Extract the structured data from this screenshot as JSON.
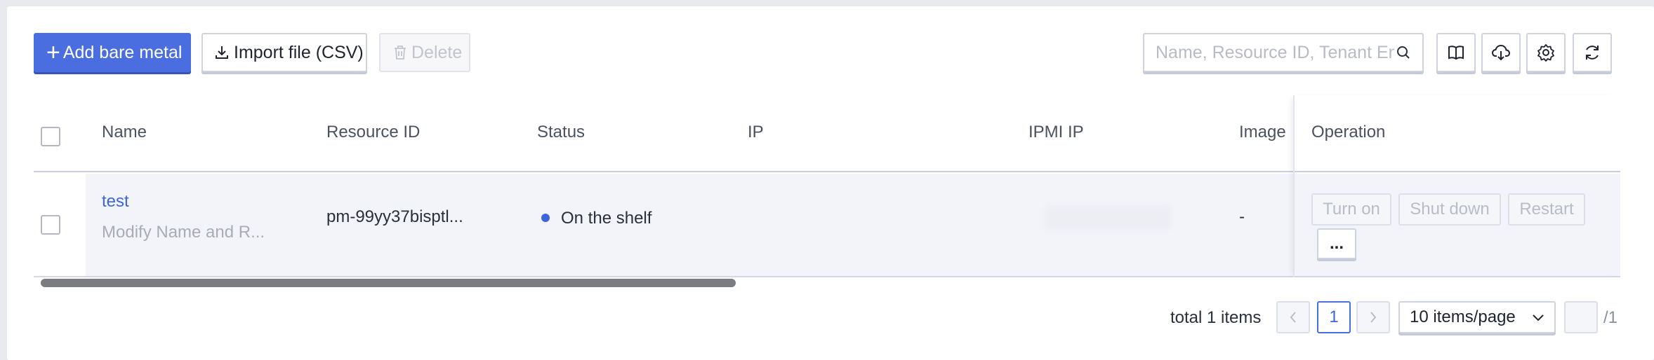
{
  "toolbar": {
    "add_label": "Add bare metal",
    "import_label": "Import file (CSV)",
    "delete_label": "Delete",
    "search_placeholder": "Name, Resource ID, Tenant En",
    "icons": [
      "book-icon",
      "cloud-download-icon",
      "gear-icon",
      "refresh-icon"
    ]
  },
  "table": {
    "columns": [
      "Name",
      "Resource ID",
      "Status",
      "IP",
      "IPMI IP",
      "Image I",
      "Operation"
    ],
    "rows": [
      {
        "name": "test",
        "description": "Modify Name and R...",
        "resource_id": "pm-99yy37bisptl...",
        "status": "On the shelf",
        "ip": "",
        "ipmi_ip": "",
        "image": "-",
        "operations": [
          "Turn on",
          "Shut down",
          "Restart"
        ],
        "more": "..."
      }
    ]
  },
  "pagination": {
    "total": "total 1 items",
    "current_page": "1",
    "page_size": "10 items/page",
    "of_pages": "/1"
  },
  "colors": {
    "accent": "#4a6edf",
    "status_dot": "#3b66db"
  }
}
